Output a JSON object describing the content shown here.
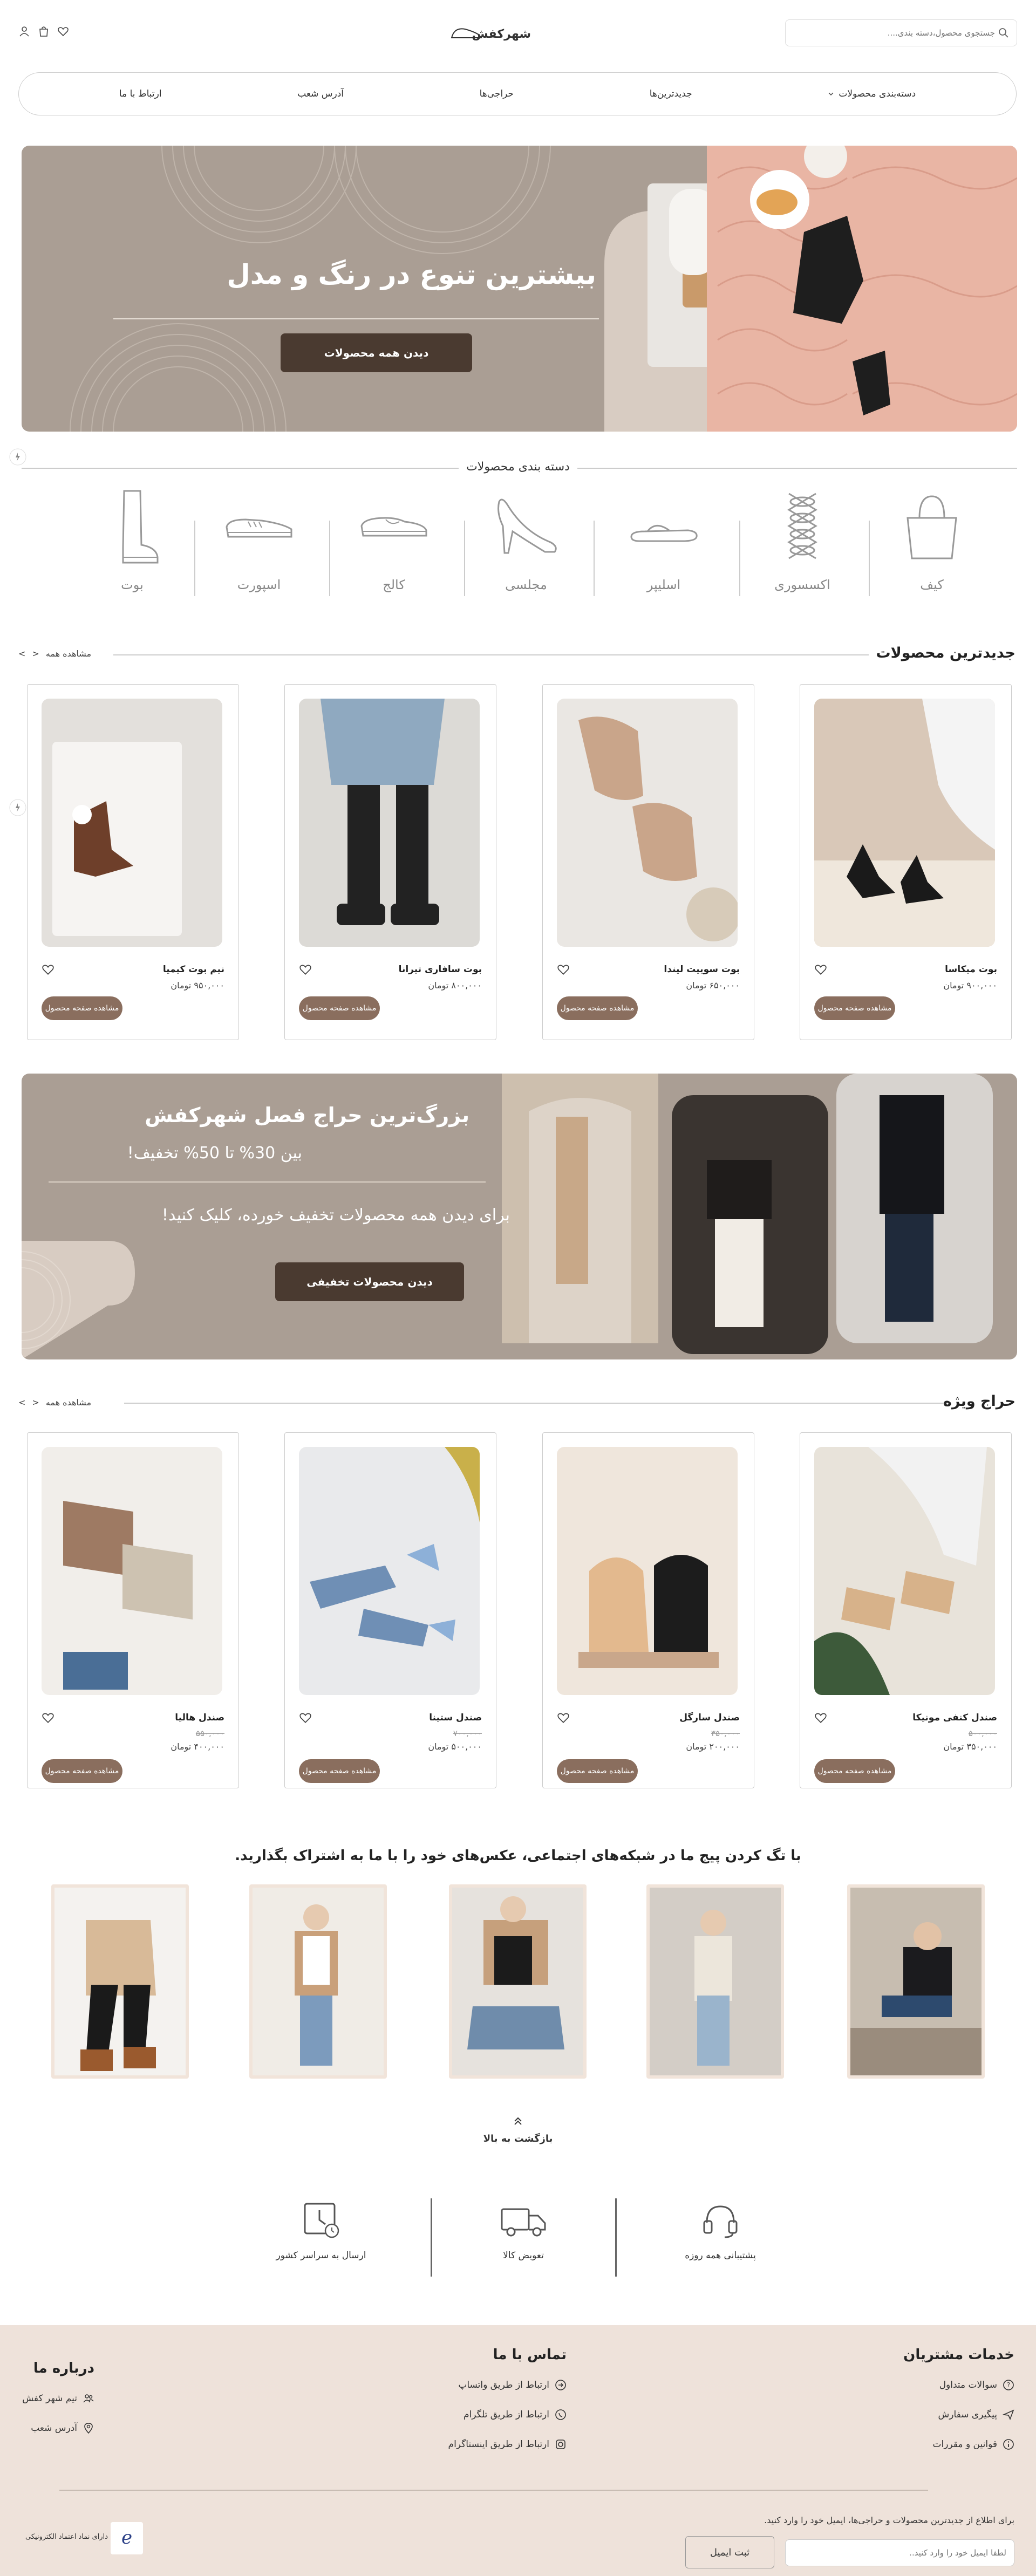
{
  "header": {
    "search_placeholder": "جستجوی محصول،دسته بندی....",
    "logo_text": "شهرکفش"
  },
  "nav": {
    "items": [
      "دسته‌بندی محصولات",
      "جدیدترین‌ها",
      "حراجی‌ها",
      "آدرس شعب",
      "ارتباط با ما"
    ]
  },
  "hero": {
    "title": "بیشترین تنوع در رنگ و مدل",
    "button": "دیدن همه محصولات"
  },
  "categories": {
    "title": "دسته بندی محصولات",
    "items": [
      {
        "label": "کیف",
        "icon": "bag-icon"
      },
      {
        "label": "اکسسوری",
        "icon": "laces-icon"
      },
      {
        "label": "اسلیپر",
        "icon": "slipper-icon"
      },
      {
        "label": "مجلسی",
        "icon": "heel-icon"
      },
      {
        "label": "کالج",
        "icon": "loafer-icon"
      },
      {
        "label": "اسپورت",
        "icon": "sneaker-icon"
      },
      {
        "label": "بوت",
        "icon": "boot-icon"
      }
    ]
  },
  "newest": {
    "title": "جدیدترین محصولات",
    "view_all": "مشاهده همه",
    "products": [
      {
        "name": "بوت میکاسا",
        "price": "۹۰۰,۰۰۰ تومان",
        "button": "مشاهده صفحه محصول"
      },
      {
        "name": "بوت سوییت لیندا",
        "price": "۶۵۰,۰۰۰ تومان",
        "button": "مشاهده صفحه محصول"
      },
      {
        "name": "بوت سافاری تیرانا",
        "price": "۸۰۰,۰۰۰ تومان",
        "button": "مشاهده صفحه محصول"
      },
      {
        "name": "نیم بوت کیمیا",
        "price": "۹۵۰,۰۰۰ تومان",
        "button": "مشاهده صفحه محصول"
      }
    ]
  },
  "sale_banner": {
    "title": "بزرگ‌ترین حراج فصل شهرکفش",
    "subtitle": "بین 30% تا 50% تخفیف!",
    "text": "برای دیدن همه محصولات تخفیف خورده، کلیک کنید!",
    "button": "دیدن محصولات تخفیفی"
  },
  "special_sale": {
    "title": "حراج ویژه",
    "view_all": "مشاهده همه",
    "products": [
      {
        "name": "صندل کنفی مونیکا",
        "old_price": "۵۰۰,۰۰۰",
        "price": "۳۵۰,۰۰۰ تومان",
        "button": "مشاهده صفحه محصول"
      },
      {
        "name": "صندل سارگل",
        "old_price": "۳۵۰,۰۰۰",
        "price": "۲۰۰,۰۰۰ تومان",
        "button": "مشاهده صفحه محصول"
      },
      {
        "name": "صندل ستینا",
        "old_price": "۷۰۰,۰۰۰",
        "price": "۵۰۰,۰۰۰ تومان",
        "button": "مشاهده صفحه محصول"
      },
      {
        "name": "صندل هالیا",
        "old_price": "۵۵۰,۰۰۰",
        "price": "۴۰۰,۰۰۰ تومان",
        "button": "مشاهده صفحه محصول"
      }
    ]
  },
  "social": {
    "title": "با تگ کردن پیج ما در شبکه‌های اجتماعی، عکس‌های خود را با ما به اشتراک بگذارید."
  },
  "back_to_top": "بازگشت به بالا",
  "services": [
    {
      "label": "پشتیبانی همه روزه",
      "icon": "headset-icon"
    },
    {
      "label": "تعویض کالا",
      "icon": "truck-icon"
    },
    {
      "label": "ارسال به سراسر کشور",
      "icon": "calendar-clock-icon"
    }
  ],
  "footer": {
    "customer_services": {
      "title": "خدمات مشتریان",
      "items": [
        "سوالات متداول",
        "پیگیری سفارش",
        "قوانین و مقررات"
      ]
    },
    "contact": {
      "title": "تماس با ما",
      "items": [
        "ارتباط از طریق واتساپ",
        "ارتباط از طریق تلگرام",
        "ارتباط از طریق اینستاگرام"
      ]
    },
    "about": {
      "title": "درباره ما",
      "items": [
        "تیم شهر کفش",
        "آدرس شعب"
      ]
    },
    "newsletter_text": "برای اطلاع از جدیدترین محصولات و حراجی‌ها، ایمیل خود را وارد کنید.",
    "email_placeholder": "لطفا ایمیل خود را وارد کنید..",
    "submit": "ثبت ایمیل",
    "enamad": "دارای نماد اعتماد الکترونیکی"
  },
  "colors": {
    "brand_beige": "#aa9e94",
    "brand_dark": "#4a3a30",
    "button_brown": "#8a6e5e",
    "footer_bg": "#eee2da"
  }
}
